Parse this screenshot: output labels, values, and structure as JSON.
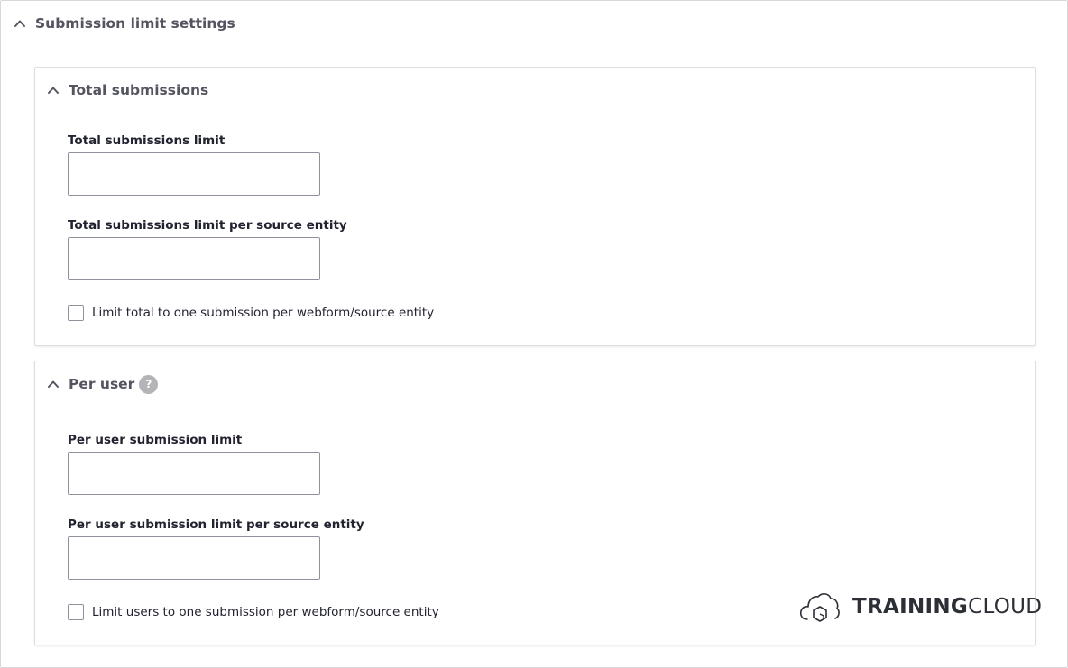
{
  "outer": {
    "title": "Submission limit settings"
  },
  "total": {
    "title": "Total submissions",
    "limit_label": "Total submissions limit",
    "limit_value": "",
    "per_source_label": "Total submissions limit per source entity",
    "per_source_value": "",
    "checkbox_label": "Limit total to one submission per webform/source entity",
    "checkbox_checked": false
  },
  "per_user": {
    "title": "Per user",
    "help_icon": "?",
    "limit_label": "Per user submission limit",
    "limit_value": "",
    "per_source_label": "Per user submission limit per source entity",
    "per_source_value": "",
    "checkbox_label": "Limit users to one submission per webform/source entity",
    "checkbox_checked": false
  },
  "brand": {
    "icon": "cloud-logo-icon",
    "bold": "TRAINING",
    "light": "CLOUD"
  },
  "colors": {
    "heading": "#545560",
    "label": "#222330",
    "border": "#8e929c",
    "help_badge": "#b4b4b8"
  }
}
